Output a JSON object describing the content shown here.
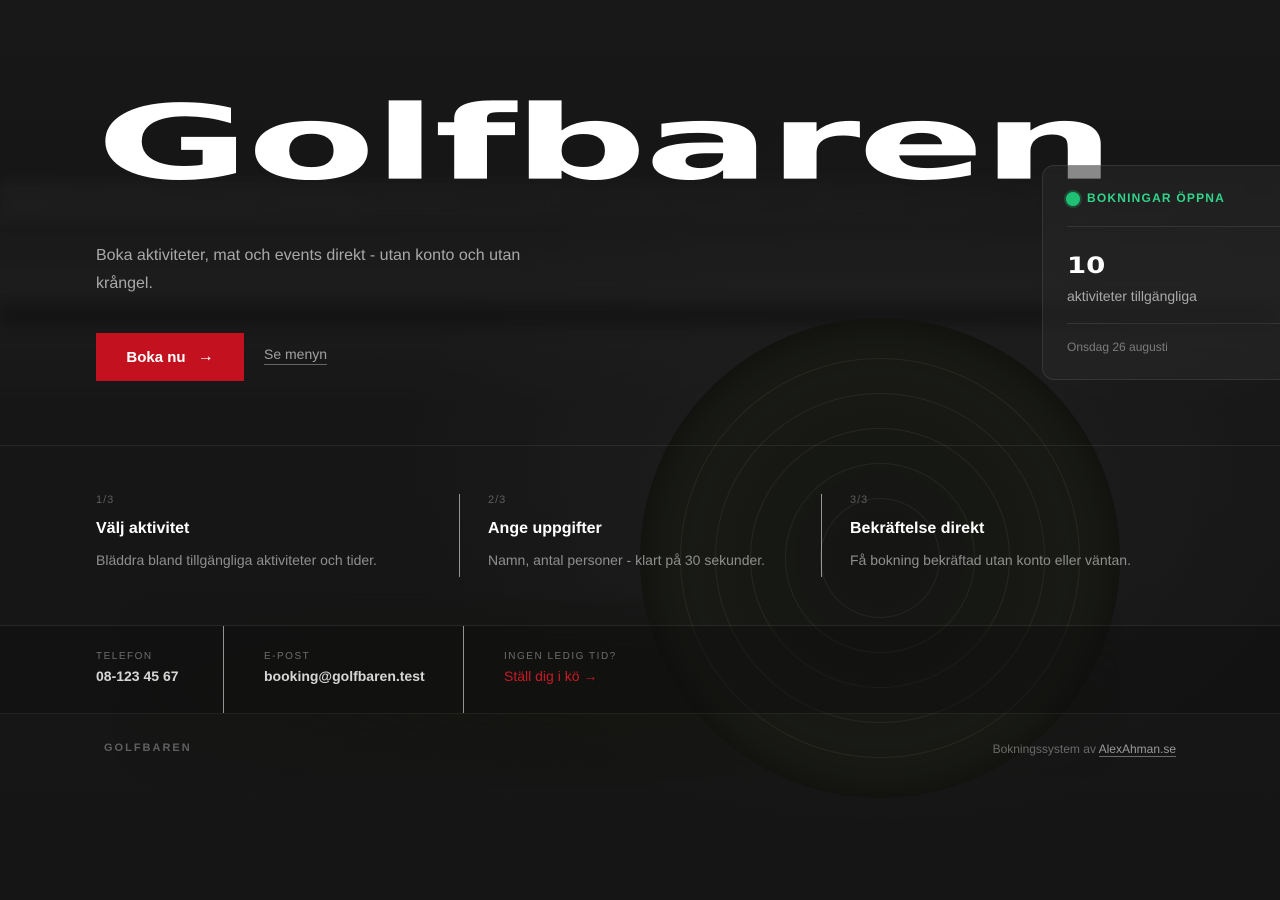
{
  "hero": {
    "title": "Golfbaren",
    "subtitle": "Boka aktiviteter, mat och events direkt - utan konto och utan krångel.",
    "primary_button": "Boka nu",
    "secondary_link": "Se menyn"
  },
  "status_card": {
    "status": "BOKNINGAR ÖPPNA",
    "count": "10",
    "count_label": "aktiviteter tillgängliga",
    "date": "Onsdag 26 augusti"
  },
  "steps": [
    {
      "num": "1/3",
      "title": "Välj aktivitet",
      "desc": "Bläddra bland tillgängliga aktiviteter och tider."
    },
    {
      "num": "2/3",
      "title": "Ange uppgifter",
      "desc": "Namn, antal personer - klart på 30 sekunder."
    },
    {
      "num": "3/3",
      "title": "Bekräftelse direkt",
      "desc": "Få bokning bekräftad utan konto eller väntan."
    }
  ],
  "contact": {
    "phone_label": "TELEFON",
    "phone": "08-123 45 67",
    "email_label": "E-POST",
    "email": "booking@golfbaren.test",
    "queue_label": "INGEN LEDIG TID?",
    "queue_link": "Ställ dig i kö →"
  },
  "footer": {
    "brand": "GOLFBAREN",
    "credit_prefix": "Bokningssystem av",
    "credit_link": "AlexAhman.se"
  },
  "colors": {
    "accent": "#c3111f",
    "status_green": "#2fd58a"
  },
  "icons": {
    "button_arrow": "arrow-right-icon",
    "status": "status-dot-icon"
  }
}
